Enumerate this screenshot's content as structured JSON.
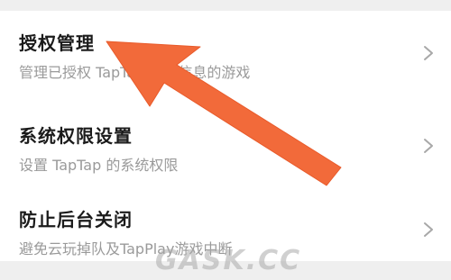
{
  "settings": {
    "items": [
      {
        "title": "授权管理",
        "subtitle": "管理已授权 TapTap 账号信息的游戏"
      },
      {
        "title": "系统权限设置",
        "subtitle": "设置 TapTap 的系统权限"
      },
      {
        "title": "防止后台关闭",
        "subtitle": "避免云玩掉队及TapPlay游戏中断"
      }
    ],
    "chevron_icon": "chevron-right-icon"
  },
  "annotation": {
    "arrow_color": "#f26a3a",
    "arrow_target": "授权管理"
  },
  "watermark": "GASK.CC",
  "colors": {
    "background": "#efefef",
    "card": "#ffffff",
    "title": "#1b1b1b",
    "subtitle": "#9a9a9a",
    "chevron": "#a8a8a8"
  }
}
